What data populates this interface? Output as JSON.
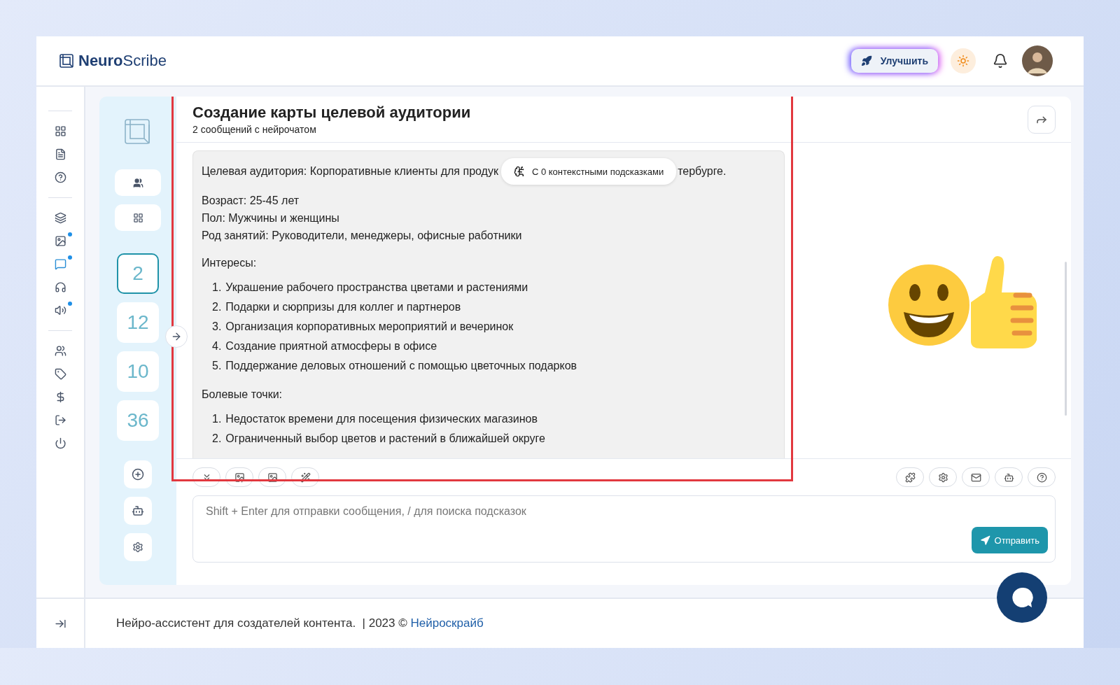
{
  "header": {
    "brand_bold": "Neuro",
    "brand_rest": "Scribe",
    "upgrade_button": "Улучшить"
  },
  "rail": {
    "groups": [
      [
        {
          "selected": false,
          "dot": false
        },
        {
          "selected": false,
          "dot": false
        },
        {
          "selected": false,
          "dot": false
        }
      ],
      [
        {
          "selected": false,
          "dot": false
        },
        {
          "selected": false,
          "dot": true
        },
        {
          "selected": true,
          "dot": true
        },
        {
          "selected": false,
          "dot": false
        },
        {
          "selected": false,
          "dot": true
        }
      ],
      [
        {
          "selected": false,
          "dot": false
        },
        {
          "selected": false,
          "dot": false
        },
        {
          "selected": false,
          "dot": false
        },
        {
          "selected": false,
          "dot": false
        },
        {
          "selected": false,
          "dot": false
        }
      ]
    ]
  },
  "panel": {
    "counters": [
      {
        "label": "2",
        "selected": true
      },
      {
        "label": "12",
        "selected": false
      },
      {
        "label": "10",
        "selected": false
      },
      {
        "label": "36",
        "selected": false
      }
    ]
  },
  "chat": {
    "title": "Создание карты целевой аудитории",
    "subtitle": "2 сообщений с нейрочатом",
    "hint_badge": "С 0 контекстными подсказками",
    "message": {
      "intro_left": "Целевая аудитория: Корпоративные клиенты для продук",
      "intro_right": "тербурге.",
      "facts": [
        "Возраст: 25-45 лет",
        "Пол: Мужчины и женщины",
        "Род занятий: Руководители, менеджеры, офисные работники"
      ],
      "sections": [
        {
          "heading": "Интересы:",
          "items": [
            {
              "number": "1.",
              "text": "Украшение рабочего пространства цветами и растениями"
            },
            {
              "number": "2.",
              "text": "Подарки и сюрпризы для коллег и партнеров"
            },
            {
              "number": "3.",
              "text": "Организация корпоративных мероприятий и вечеринок"
            },
            {
              "number": "4.",
              "text": "Создание приятной атмосферы в офисе"
            },
            {
              "number": "5.",
              "text": "Поддержание деловых отношений с помощью цветочных подарков"
            }
          ]
        },
        {
          "heading": "Болевые точки:",
          "items": [
            {
              "number": "1.",
              "text": "Недостаток времени для посещения физических магазинов"
            },
            {
              "number": "2.",
              "text": "Ограниченный выбор цветов и растений в ближайшей округе"
            }
          ]
        }
      ]
    },
    "input": {
      "placeholder": "Shift + Enter для отправки сообщения, / для поиска подсказок"
    },
    "send_button": "Отправить",
    "highlighted": true
  },
  "footer": {
    "text": "Нейро-ассистент для создателей контента.  | 2023 © ",
    "link": "Нейроскрайб"
  }
}
